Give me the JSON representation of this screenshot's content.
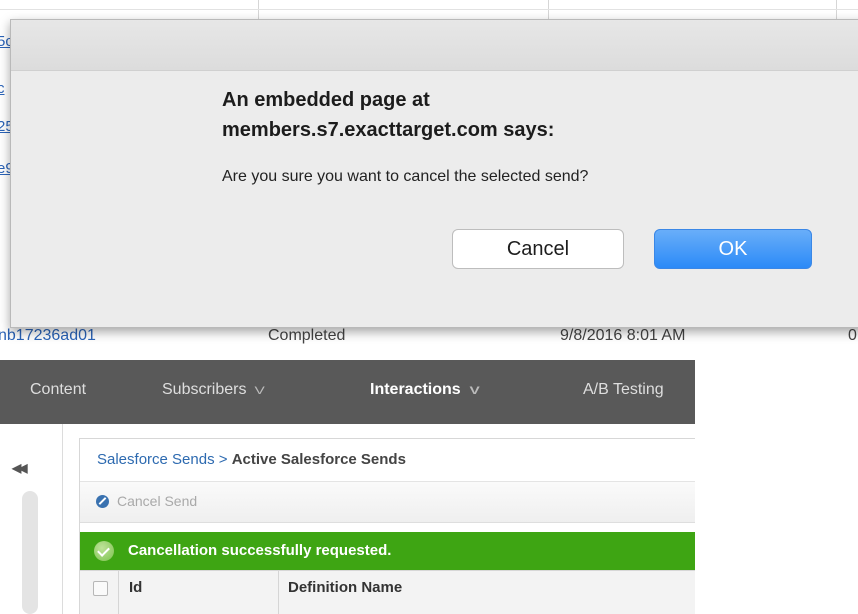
{
  "dialog": {
    "heading_line1": "An embedded page at",
    "heading_line2": "members.s7.exacttarget.com says:",
    "message": "Are you sure you want to cancel the selected send?",
    "cancel_label": "Cancel",
    "ok_label": "OK"
  },
  "background_table": {
    "peek_links": [
      "5c",
      "c",
      "25",
      "e9"
    ],
    "bottom_row": [
      "nb17236ad01",
      "Completed",
      "9/8/2016 8:01 AM",
      "0"
    ]
  },
  "nav": {
    "items": [
      {
        "label": "Content",
        "has_dropdown": false,
        "active": false
      },
      {
        "label": "Subscribers",
        "has_dropdown": true,
        "active": false
      },
      {
        "label": "Interactions",
        "has_dropdown": true,
        "active": true
      },
      {
        "label": "A/B Testing",
        "has_dropdown": false,
        "active": false
      }
    ],
    "dropdown_glyph": "V"
  },
  "sidebar": {
    "collapse_glyph": "◀◀"
  },
  "breadcrumb": {
    "parent": "Salesforce Sends",
    "separator": " > ",
    "current": "Active Salesforce Sends"
  },
  "toolbar": {
    "cancel_send_label": "Cancel Send"
  },
  "status": {
    "success_message": "Cancellation successfully requested."
  },
  "table": {
    "columns": [
      "Id",
      "Definition Name"
    ]
  },
  "colors": {
    "success": "#3ea513",
    "ok_button": "#2b8af7",
    "navbar": "#595959",
    "link": "#2d6ab0"
  }
}
